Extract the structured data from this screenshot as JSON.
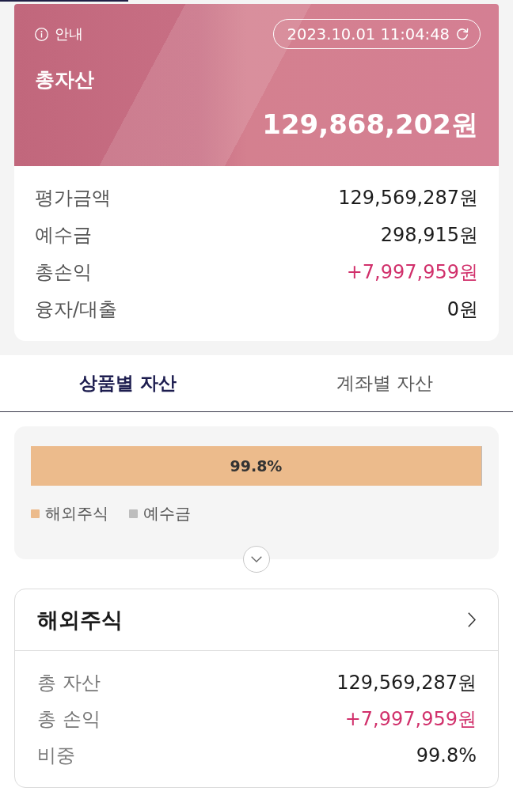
{
  "summary": {
    "info_label": "안내",
    "timestamp": "2023.10.01 11:04:48",
    "title": "총자산",
    "total": "129,868,202원",
    "rows": [
      {
        "label": "평가금액",
        "value": "129,569,287원",
        "kind": "plain"
      },
      {
        "label": "예수금",
        "value": "298,915원",
        "kind": "plain"
      },
      {
        "label": "총손익",
        "value": "+7,997,959원",
        "kind": "gain"
      },
      {
        "label": "융자/대출",
        "value": "0원",
        "kind": "plain"
      }
    ]
  },
  "tabs": [
    {
      "label": "상품별 자산",
      "selected": true
    },
    {
      "label": "계좌별 자산",
      "selected": false
    }
  ],
  "allocation": {
    "level": 0.998,
    "label": "99.8%",
    "legend": [
      {
        "label": "해외주식",
        "color": "#ecbb8c"
      },
      {
        "label": "예수금",
        "color": "#bdbdbd"
      }
    ]
  },
  "product_card": {
    "title": "해외주식",
    "rows": [
      {
        "label": "총 자산",
        "value": "129,569,287원",
        "kind": "plain"
      },
      {
        "label": "총 손익",
        "value": "+7,997,959원",
        "kind": "gain"
      },
      {
        "label": "비중",
        "value": "99.8%",
        "kind": "plain"
      }
    ]
  }
}
